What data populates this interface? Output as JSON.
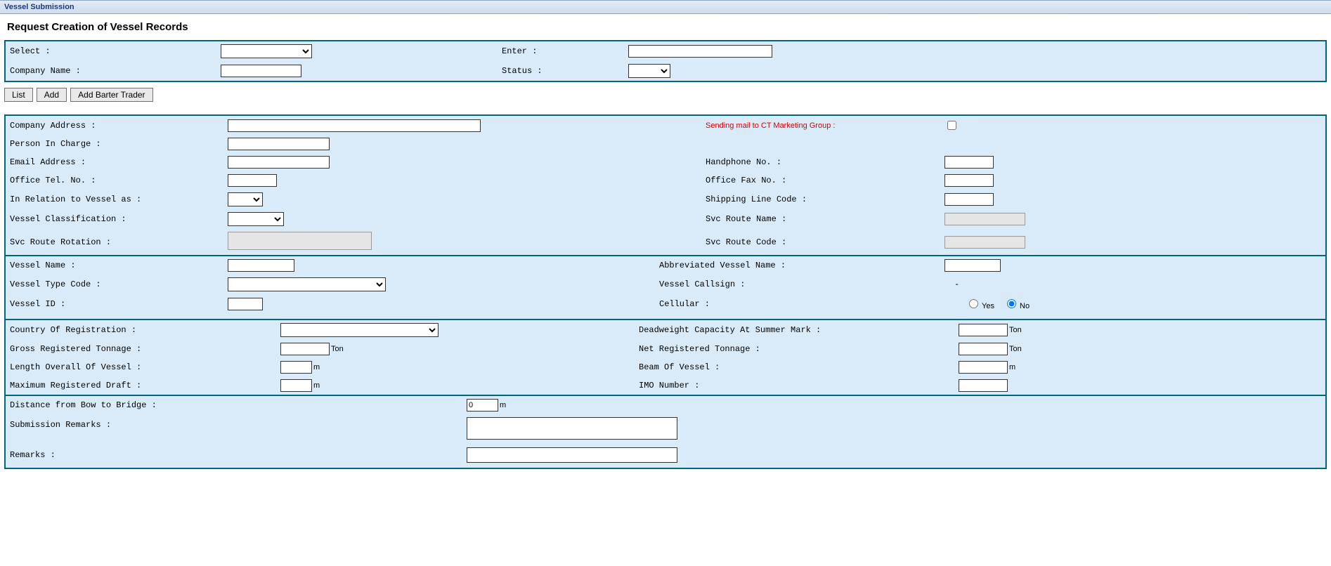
{
  "header": {
    "title": "Vessel Submission"
  },
  "page": {
    "title": "Request Creation of Vessel Records"
  },
  "filter": {
    "select_label": "Select :",
    "enter_label": "Enter :",
    "company_name_label": "Company Name :",
    "status_label": "Status :"
  },
  "buttons": {
    "list": "List",
    "add": "Add",
    "add_barter_trader": "Add Barter Trader"
  },
  "section1": {
    "company_address": "Company Address :",
    "sending_mail": "Sending mail to CT Marketing Group :",
    "person_in_charge": "Person In Charge :",
    "email_address": "Email Address :",
    "handphone_no": "Handphone No. :",
    "office_tel_no": "Office Tel. No. :",
    "office_fax_no": "Office Fax No. :",
    "in_relation": "In Relation to Vessel as :",
    "shipping_line_code": "Shipping Line Code :",
    "vessel_classification": "Vessel Classification :",
    "svc_route_name": "Svc Route Name :",
    "svc_route_rotation": "Svc Route Rotation :",
    "svc_route_code": "Svc Route Code :"
  },
  "section2": {
    "vessel_name": "Vessel Name :",
    "abbrev_vessel_name": "Abbreviated Vessel Name :",
    "vessel_type_code": "Vessel Type Code :",
    "vessel_callsign": "Vessel Callsign :",
    "vessel_callsign_value": "-",
    "vessel_id": "Vessel ID :",
    "cellular": "Cellular :",
    "cellular_yes": "Yes",
    "cellular_no": "No"
  },
  "section3": {
    "country_of_registration": "Country Of Registration :",
    "deadweight_capacity": "Deadweight Capacity At Summer Mark :",
    "gross_registered_tonnage": "Gross Registered Tonnage :",
    "net_registered_tonnage": "Net Registered Tonnage :",
    "length_overall": "Length Overall Of Vessel :",
    "beam_of_vessel": "Beam Of Vessel :",
    "maximum_registered_draft": "Maximum Registered Draft :",
    "imo_number": "IMO Number :",
    "unit_ton": "Ton",
    "unit_m": "m"
  },
  "section4": {
    "distance_bow_bridge": "Distance from Bow to Bridge :",
    "distance_value": "0",
    "unit_m": "m",
    "submission_remarks": "Submission Remarks :",
    "remarks": "Remarks :"
  }
}
